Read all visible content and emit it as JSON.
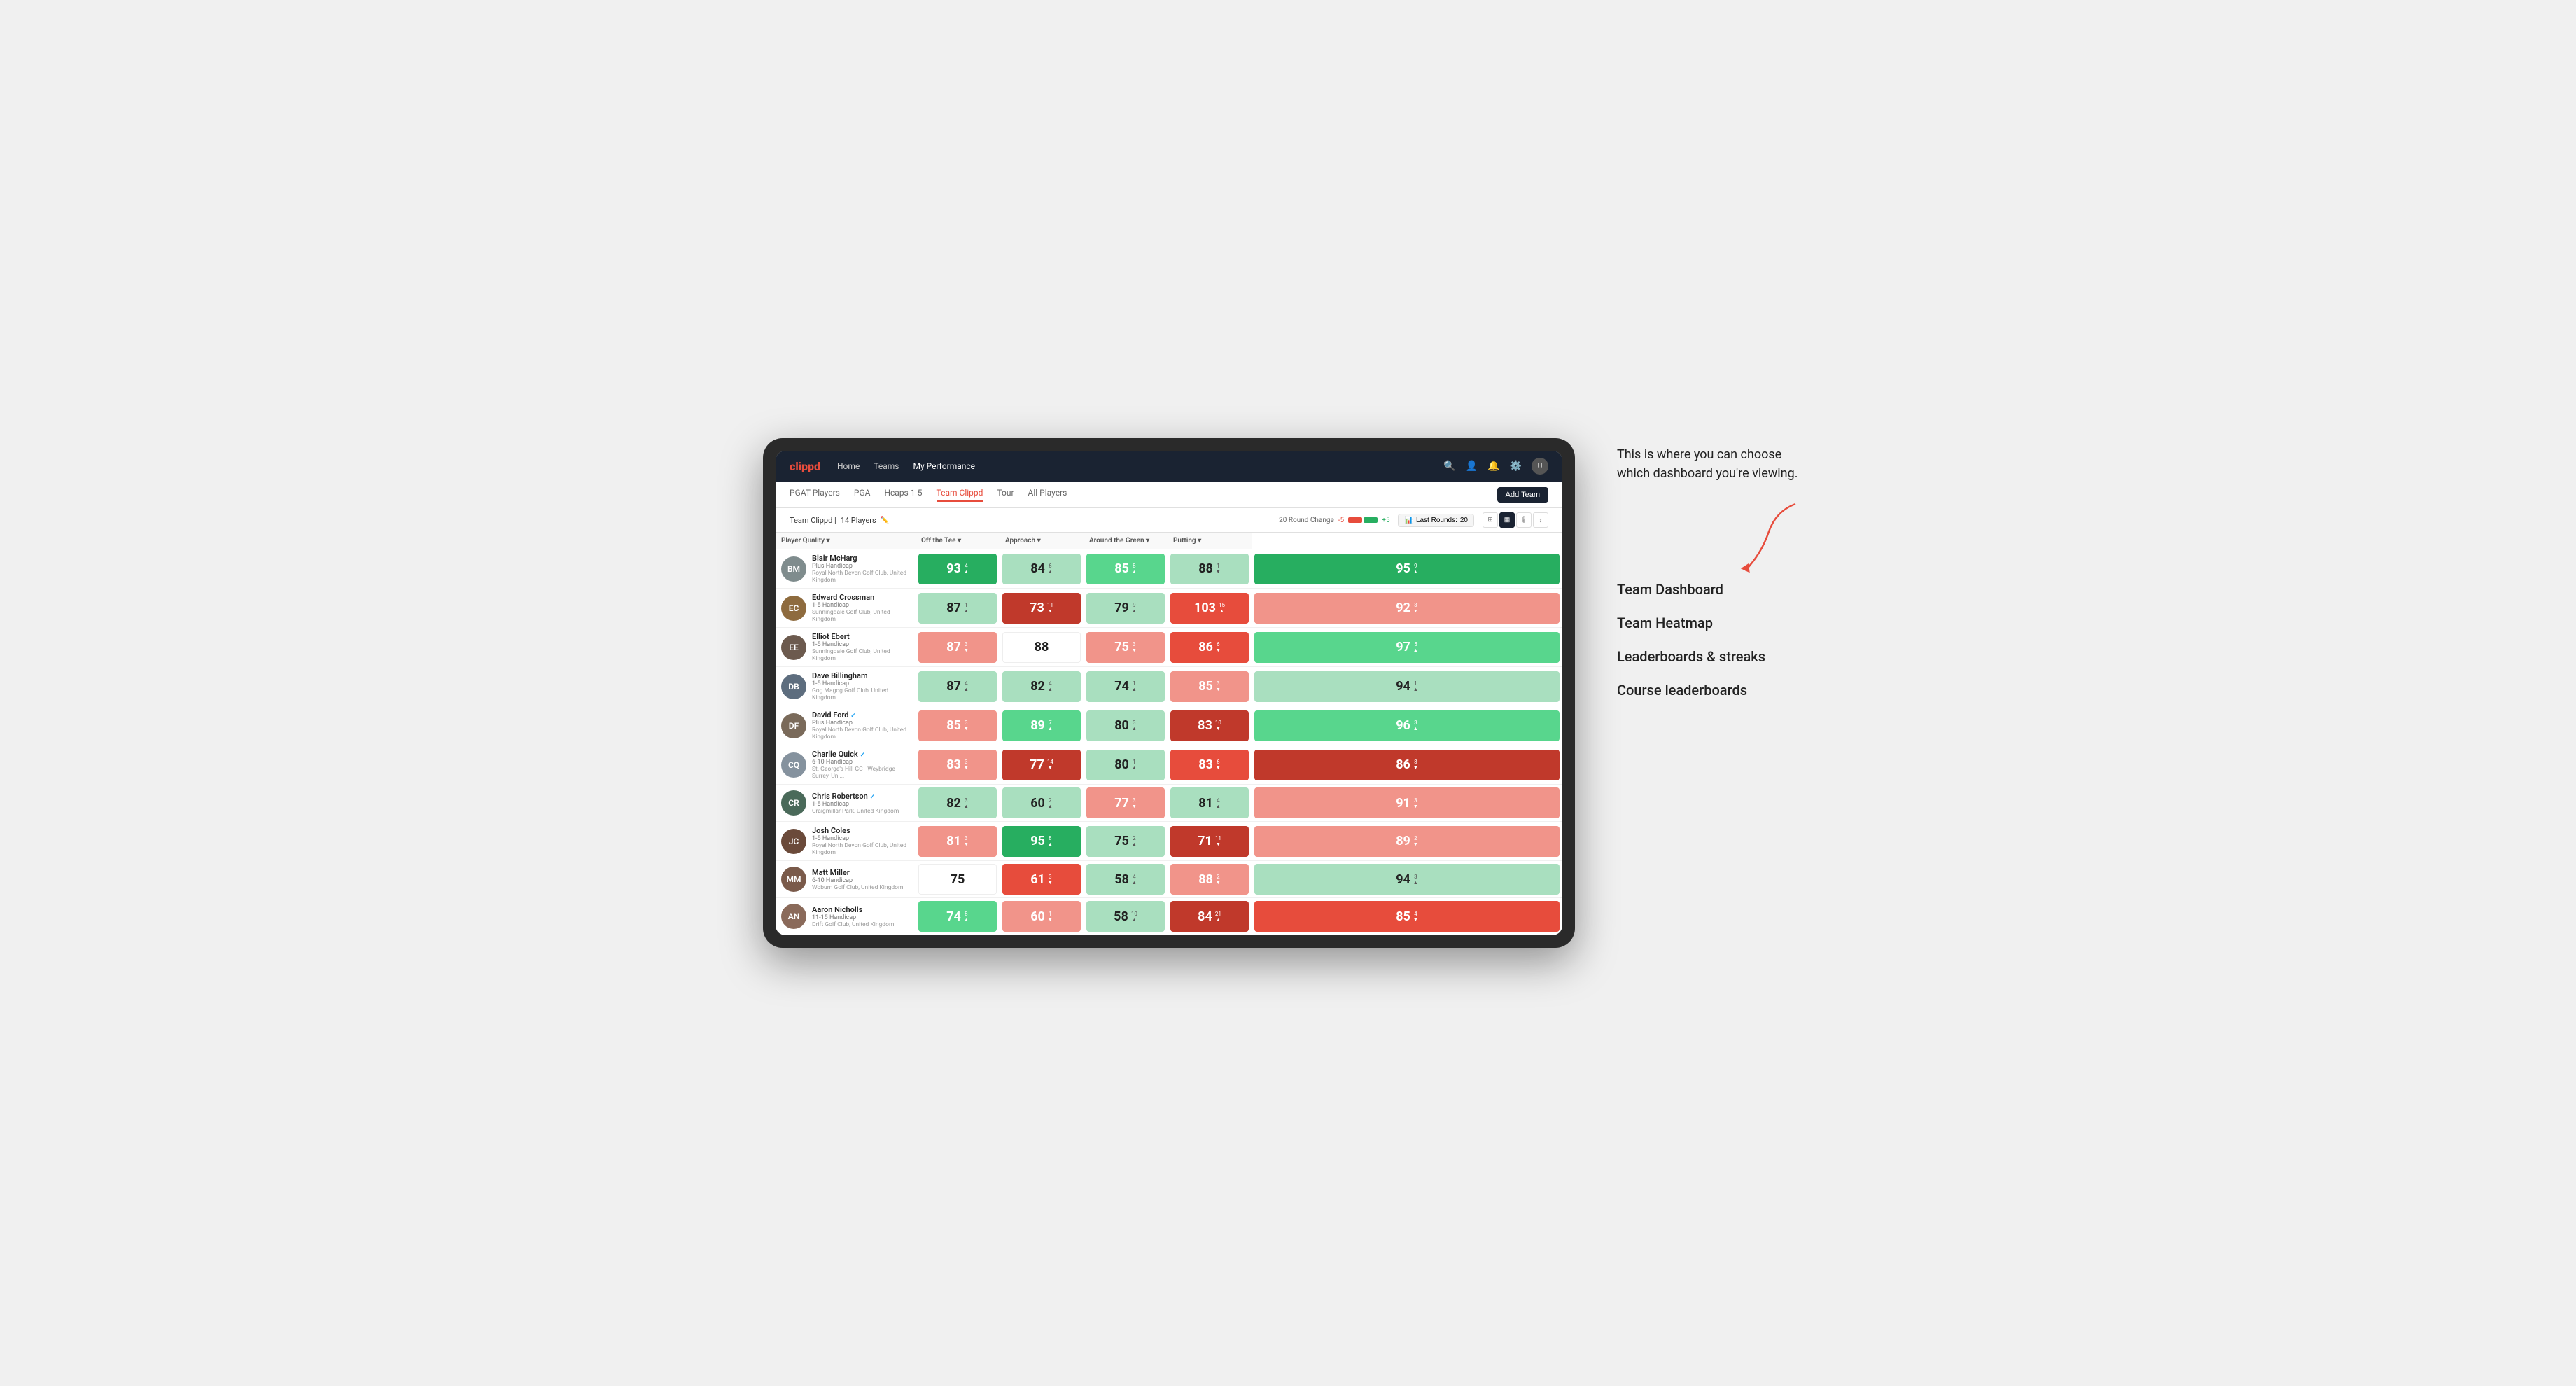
{
  "annotation": {
    "intro_text": "This is where you can choose which dashboard you're viewing.",
    "items": [
      {
        "label": "Team Dashboard"
      },
      {
        "label": "Team Heatmap"
      },
      {
        "label": "Leaderboards & streaks"
      },
      {
        "label": "Course leaderboards"
      }
    ]
  },
  "nav": {
    "logo": "clippd",
    "links": [
      "Home",
      "Teams",
      "My Performance"
    ],
    "active_link": "My Performance"
  },
  "sub_nav": {
    "links": [
      "PGAT Players",
      "PGA",
      "Hcaps 1-5",
      "Team Clippd",
      "Tour",
      "All Players"
    ],
    "active_link": "Team Clippd",
    "add_team_label": "Add Team"
  },
  "team_header": {
    "team_name": "Team Clippd",
    "player_count": "14 Players",
    "round_change_label": "20 Round Change",
    "round_change_neg": "-5",
    "round_change_pos": "+5",
    "last_rounds_label": "Last Rounds:",
    "last_rounds_value": "20"
  },
  "table": {
    "columns": {
      "player": "Player Quality",
      "off_tee": "Off the Tee",
      "approach": "Approach",
      "around_green": "Around the Green",
      "putting": "Putting"
    },
    "rows": [
      {
        "name": "Blair McHarg",
        "handicap": "Plus Handicap",
        "club": "Royal North Devon Golf Club, United Kingdom",
        "initials": "BM",
        "avatar_color": "#7f8c8d",
        "player_quality": {
          "value": "93",
          "change": "4",
          "dir": "up",
          "color": "green-dark"
        },
        "off_tee": {
          "value": "84",
          "change": "6",
          "dir": "up",
          "color": "green-light"
        },
        "approach": {
          "value": "85",
          "change": "8",
          "dir": "up",
          "color": "green-mid"
        },
        "around_green": {
          "value": "88",
          "change": "1",
          "dir": "down",
          "color": "green-light"
        },
        "putting": {
          "value": "95",
          "change": "9",
          "dir": "up",
          "color": "green-dark"
        }
      },
      {
        "name": "Edward Crossman",
        "handicap": "1-5 Handicap",
        "club": "Sunningdale Golf Club, United Kingdom",
        "initials": "EC",
        "avatar_color": "#8e6b3e",
        "player_quality": {
          "value": "87",
          "change": "1",
          "dir": "up",
          "color": "green-light"
        },
        "off_tee": {
          "value": "73",
          "change": "11",
          "dir": "down",
          "color": "red-dark"
        },
        "approach": {
          "value": "79",
          "change": "9",
          "dir": "up",
          "color": "green-light"
        },
        "around_green": {
          "value": "103",
          "change": "15",
          "dir": "up",
          "color": "red-mid"
        },
        "putting": {
          "value": "92",
          "change": "3",
          "dir": "down",
          "color": "red-light"
        }
      },
      {
        "name": "Elliot Ebert",
        "handicap": "1-5 Handicap",
        "club": "Sunningdale Golf Club, United Kingdom",
        "initials": "EE",
        "avatar_color": "#6c5a4e",
        "player_quality": {
          "value": "87",
          "change": "3",
          "dir": "down",
          "color": "red-light"
        },
        "off_tee": {
          "value": "88",
          "change": "",
          "dir": "",
          "color": "neutral"
        },
        "approach": {
          "value": "75",
          "change": "3",
          "dir": "down",
          "color": "red-light"
        },
        "around_green": {
          "value": "86",
          "change": "6",
          "dir": "down",
          "color": "red-mid"
        },
        "putting": {
          "value": "97",
          "change": "5",
          "dir": "up",
          "color": "green-mid"
        }
      },
      {
        "name": "Dave Billingham",
        "handicap": "1-5 Handicap",
        "club": "Gog Magog Golf Club, United Kingdom",
        "initials": "DB",
        "avatar_color": "#5d6d7e",
        "player_quality": {
          "value": "87",
          "change": "4",
          "dir": "up",
          "color": "green-light"
        },
        "off_tee": {
          "value": "82",
          "change": "4",
          "dir": "up",
          "color": "green-light"
        },
        "approach": {
          "value": "74",
          "change": "1",
          "dir": "up",
          "color": "green-light"
        },
        "around_green": {
          "value": "85",
          "change": "3",
          "dir": "down",
          "color": "red-light"
        },
        "putting": {
          "value": "94",
          "change": "1",
          "dir": "up",
          "color": "green-light"
        }
      },
      {
        "name": "David Ford",
        "handicap": "Plus Handicap",
        "club": "Royal North Devon Golf Club, United Kingdom",
        "initials": "DF",
        "avatar_color": "#7a6a5a",
        "verified": true,
        "player_quality": {
          "value": "85",
          "change": "3",
          "dir": "down",
          "color": "red-light"
        },
        "off_tee": {
          "value": "89",
          "change": "7",
          "dir": "up",
          "color": "green-mid"
        },
        "approach": {
          "value": "80",
          "change": "3",
          "dir": "up",
          "color": "green-light"
        },
        "around_green": {
          "value": "83",
          "change": "10",
          "dir": "down",
          "color": "red-dark"
        },
        "putting": {
          "value": "96",
          "change": "3",
          "dir": "up",
          "color": "green-mid"
        }
      },
      {
        "name": "Charlie Quick",
        "handicap": "6-10 Handicap",
        "club": "St. George's Hill GC - Weybridge - Surrey, Uni...",
        "initials": "CQ",
        "avatar_color": "#85929e",
        "verified": true,
        "player_quality": {
          "value": "83",
          "change": "3",
          "dir": "down",
          "color": "red-light"
        },
        "off_tee": {
          "value": "77",
          "change": "14",
          "dir": "down",
          "color": "red-dark"
        },
        "approach": {
          "value": "80",
          "change": "1",
          "dir": "up",
          "color": "green-light"
        },
        "around_green": {
          "value": "83",
          "change": "6",
          "dir": "down",
          "color": "red-mid"
        },
        "putting": {
          "value": "86",
          "change": "8",
          "dir": "down",
          "color": "red-dark"
        }
      },
      {
        "name": "Chris Robertson",
        "handicap": "1-5 Handicap",
        "club": "Craigmillar Park, United Kingdom",
        "initials": "CR",
        "avatar_color": "#4a6a5a",
        "verified": true,
        "player_quality": {
          "value": "82",
          "change": "3",
          "dir": "up",
          "color": "green-light"
        },
        "off_tee": {
          "value": "60",
          "change": "2",
          "dir": "up",
          "color": "green-light"
        },
        "approach": {
          "value": "77",
          "change": "3",
          "dir": "down",
          "color": "red-light"
        },
        "around_green": {
          "value": "81",
          "change": "4",
          "dir": "up",
          "color": "green-light"
        },
        "putting": {
          "value": "91",
          "change": "3",
          "dir": "down",
          "color": "red-light"
        }
      },
      {
        "name": "Josh Coles",
        "handicap": "1-5 Handicap",
        "club": "Royal North Devon Golf Club, United Kingdom",
        "initials": "JC",
        "avatar_color": "#6b4a3a",
        "player_quality": {
          "value": "81",
          "change": "3",
          "dir": "down",
          "color": "red-light"
        },
        "off_tee": {
          "value": "95",
          "change": "8",
          "dir": "up",
          "color": "green-dark"
        },
        "approach": {
          "value": "75",
          "change": "2",
          "dir": "up",
          "color": "green-light"
        },
        "around_green": {
          "value": "71",
          "change": "11",
          "dir": "down",
          "color": "red-dark"
        },
        "putting": {
          "value": "89",
          "change": "2",
          "dir": "down",
          "color": "red-light"
        }
      },
      {
        "name": "Matt Miller",
        "handicap": "6-10 Handicap",
        "club": "Woburn Golf Club, United Kingdom",
        "initials": "MM",
        "avatar_color": "#7a5a4a",
        "player_quality": {
          "value": "75",
          "change": "",
          "dir": "",
          "color": "neutral"
        },
        "off_tee": {
          "value": "61",
          "change": "3",
          "dir": "down",
          "color": "red-mid"
        },
        "approach": {
          "value": "58",
          "change": "4",
          "dir": "up",
          "color": "green-light"
        },
        "around_green": {
          "value": "88",
          "change": "2",
          "dir": "down",
          "color": "red-light"
        },
        "putting": {
          "value": "94",
          "change": "3",
          "dir": "up",
          "color": "green-light"
        }
      },
      {
        "name": "Aaron Nicholls",
        "handicap": "11-15 Handicap",
        "club": "Drift Golf Club, United Kingdom",
        "initials": "AN",
        "avatar_color": "#8a6a5a",
        "player_quality": {
          "value": "74",
          "change": "8",
          "dir": "up",
          "color": "green-mid"
        },
        "off_tee": {
          "value": "60",
          "change": "1",
          "dir": "down",
          "color": "red-light"
        },
        "approach": {
          "value": "58",
          "change": "10",
          "dir": "up",
          "color": "green-light"
        },
        "around_green": {
          "value": "84",
          "change": "21",
          "dir": "up",
          "color": "red-dark"
        },
        "putting": {
          "value": "85",
          "change": "4",
          "dir": "down",
          "color": "red-mid"
        }
      }
    ]
  }
}
